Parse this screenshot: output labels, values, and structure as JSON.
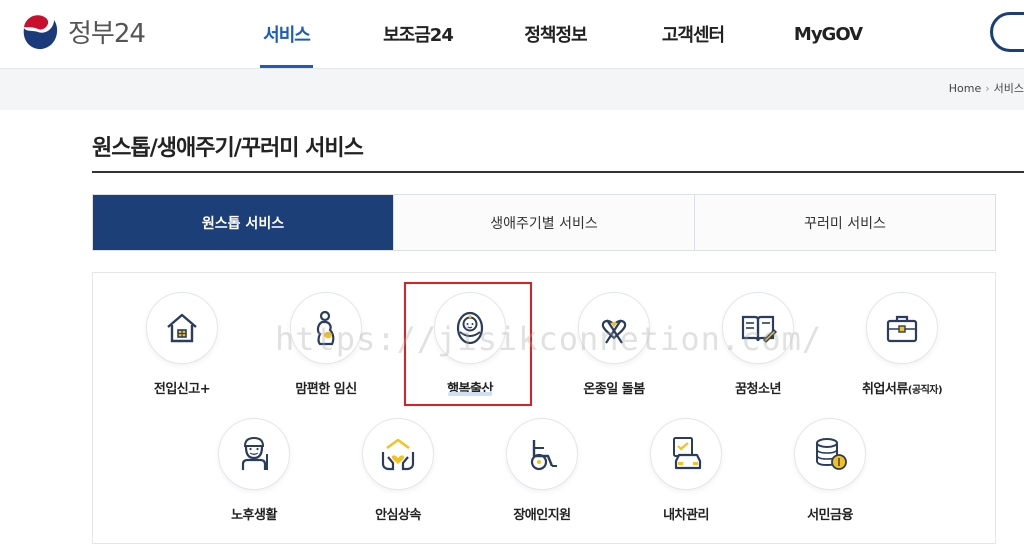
{
  "header": {
    "logo_text": "정부24",
    "nav": [
      "서비스",
      "보조금24",
      "정책정보",
      "고객센터",
      "MyGOV"
    ],
    "active_nav": "서비스"
  },
  "breadcrumb": {
    "home": "Home",
    "current": "서비스"
  },
  "page_title": "원스톱/생애주기/꾸러미 서비스",
  "tabs": [
    {
      "label": "원스톱 서비스",
      "active": true
    },
    {
      "label": "생애주기별 서비스",
      "active": false
    },
    {
      "label": "꾸러미 서비스",
      "active": false
    }
  ],
  "services": [
    {
      "label": "전입신고+",
      "icon": "house-icon"
    },
    {
      "label": "맘편한 임신",
      "icon": "pregnant-woman-icon"
    },
    {
      "label": "행복출산",
      "icon": "baby-icon"
    },
    {
      "label": "온종일 돌봄",
      "icon": "ribbon-heart-icon"
    },
    {
      "label": "꿈청소년",
      "icon": "open-book-icon"
    },
    {
      "label": "취업서류",
      "label_suffix": "(공직자)",
      "icon": "briefcase-icon"
    },
    {
      "label": "노후생활",
      "icon": "elderly-person-icon"
    },
    {
      "label": "안심상속",
      "icon": "hands-heart-house-icon"
    },
    {
      "label": "장애인지원",
      "icon": "wheelchair-icon"
    },
    {
      "label": "내차관리",
      "icon": "car-document-icon"
    },
    {
      "label": "서민금융",
      "icon": "coins-icon"
    }
  ],
  "watermark": "https://jisikconnetion.com/",
  "colors": {
    "primary_navy": "#1d3f78",
    "nav_active_blue": "#1a5bc4",
    "icon_accent_yellow": "#f5c21b",
    "highlight_red": "#e02020"
  }
}
